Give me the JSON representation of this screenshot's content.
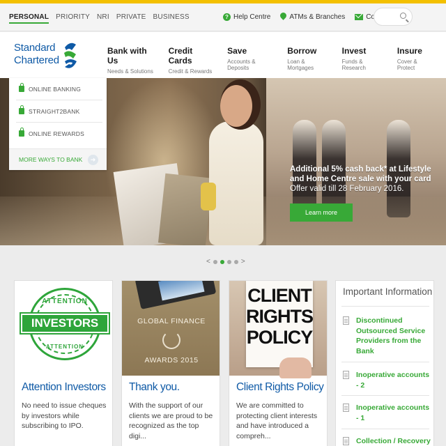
{
  "segments": [
    "PERSONAL",
    "PRIORITY",
    "NRI",
    "PRIVATE",
    "BUSINESS"
  ],
  "utility": {
    "help": "Help Centre",
    "atms": "ATMs & Branches",
    "contact": "Contact Us"
  },
  "logo": {
    "line1": "Standard",
    "line2": "Chartered"
  },
  "mainnav": [
    {
      "title": "Bank with Us",
      "sub": "Needs & Solutions"
    },
    {
      "title": "Credit Cards",
      "sub": "Credit & Rewards"
    },
    {
      "title": "Save",
      "sub": "Accounts & Deposits"
    },
    {
      "title": "Borrow",
      "sub": "Loan & Mortgages"
    },
    {
      "title": "Invest",
      "sub": "Funds & Research"
    },
    {
      "title": "Insure",
      "sub": "Cover & Protect"
    }
  ],
  "dropdown": {
    "items": [
      "ONLINE BANKING",
      "STRAIGHT2BANK",
      "ONLINE REWARDS"
    ],
    "more": "MORE WAYS TO BANK"
  },
  "hero": {
    "headline": "Additional 5% cash back* at Lifestyle and Home Centre sale with your card",
    "validity": "Offer valid till 28 February 2016.",
    "cta": "Learn more"
  },
  "pager": {
    "prev": "<",
    "next": ">"
  },
  "cards": [
    {
      "title": "Attention Investors",
      "text": "No need to issue cheques by investors while subscribing to IPO.",
      "stamp_top": "ATTENTION",
      "stamp_main": "INVESTORS",
      "stamp_bottom": "ATTENTION"
    },
    {
      "title": "Thank you.",
      "text": "With the support of our clients we are proud to be recognized as the top digi...",
      "img_line1": "GLOBAL FINANCE",
      "img_line2": "AWARDS 2015"
    },
    {
      "title": "Client Rights Policy",
      "text": "We are committed to protecting client interests and have introduced a compreh...",
      "img_lines": [
        "CLIENT",
        "RIGHTS",
        "POLICY"
      ]
    }
  ],
  "important": {
    "title": "Important Information",
    "items": [
      "Discontinued Outsourced Service Providers from the Bank",
      "Inoperative accounts - 2",
      "Inoperative accounts - 1",
      "Collection / Recovery"
    ]
  },
  "colors": {
    "accent_green": "#38a937",
    "brand_blue": "#0f5aa6",
    "top_stripe": "#f3c000"
  }
}
